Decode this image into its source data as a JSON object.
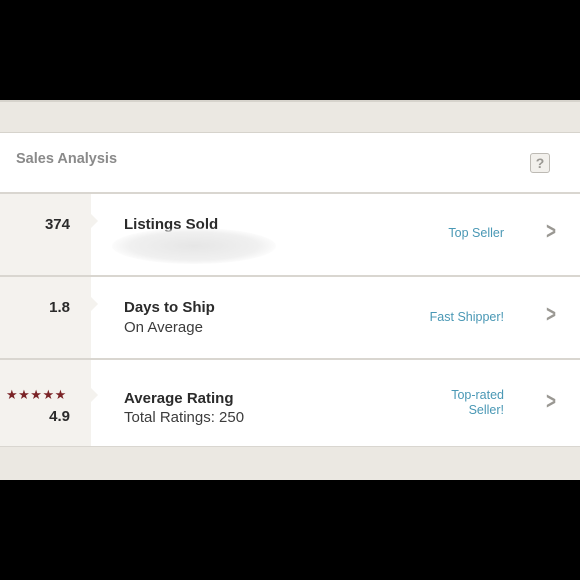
{
  "header": {
    "title": "Sales Analysis",
    "help_label": "?"
  },
  "rows": [
    {
      "value": "374",
      "label": "Listings Sold",
      "sub": "",
      "badge_lines": [
        "Top Seller"
      ]
    },
    {
      "value": "1.8",
      "label": "Days to Ship",
      "sub": "On Average",
      "badge_lines": [
        "Fast Shipper!"
      ]
    },
    {
      "value": "4.9",
      "stars": "★★★★★",
      "star_rating": 5,
      "label": "Average Rating",
      "sub": "Total Ratings: 250",
      "badge_lines": [
        "Top-rated",
        "Seller!"
      ]
    }
  ],
  "colors": {
    "accent": "#4a98b5",
    "star": "#7a2326",
    "panel": "#f4f2ee",
    "background": "#ebe8e2"
  },
  "icons": {
    "help": "help-icon",
    "chevron": "chevron-right-icon",
    "star": "star-icon"
  }
}
